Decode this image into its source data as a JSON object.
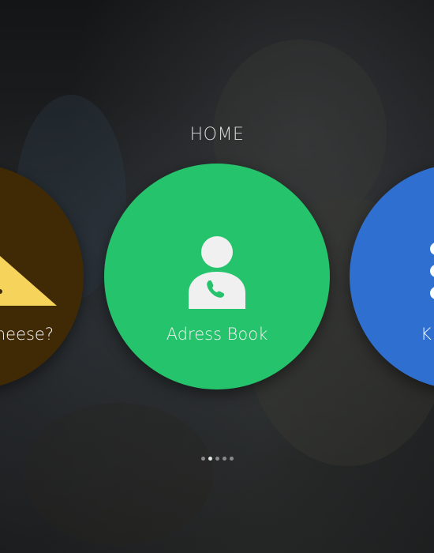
{
  "header": {
    "title": "HOME"
  },
  "tiles": [
    {
      "id": "warning",
      "label": "heese?",
      "icon": "warning-triangle-icon",
      "color": "#3f2a05",
      "icon_color": "#f6d35a"
    },
    {
      "id": "address-book",
      "label": "Adress Book",
      "icon": "contact-phone-icon",
      "color": "#25c36b",
      "icon_color": "#f0f0f0"
    },
    {
      "id": "keypad",
      "label": "K",
      "icon": "dots-icon",
      "color": "#2f6fcf",
      "icon_color": "#ffffff"
    }
  ],
  "pager": {
    "count": 5,
    "active_index": 1
  }
}
